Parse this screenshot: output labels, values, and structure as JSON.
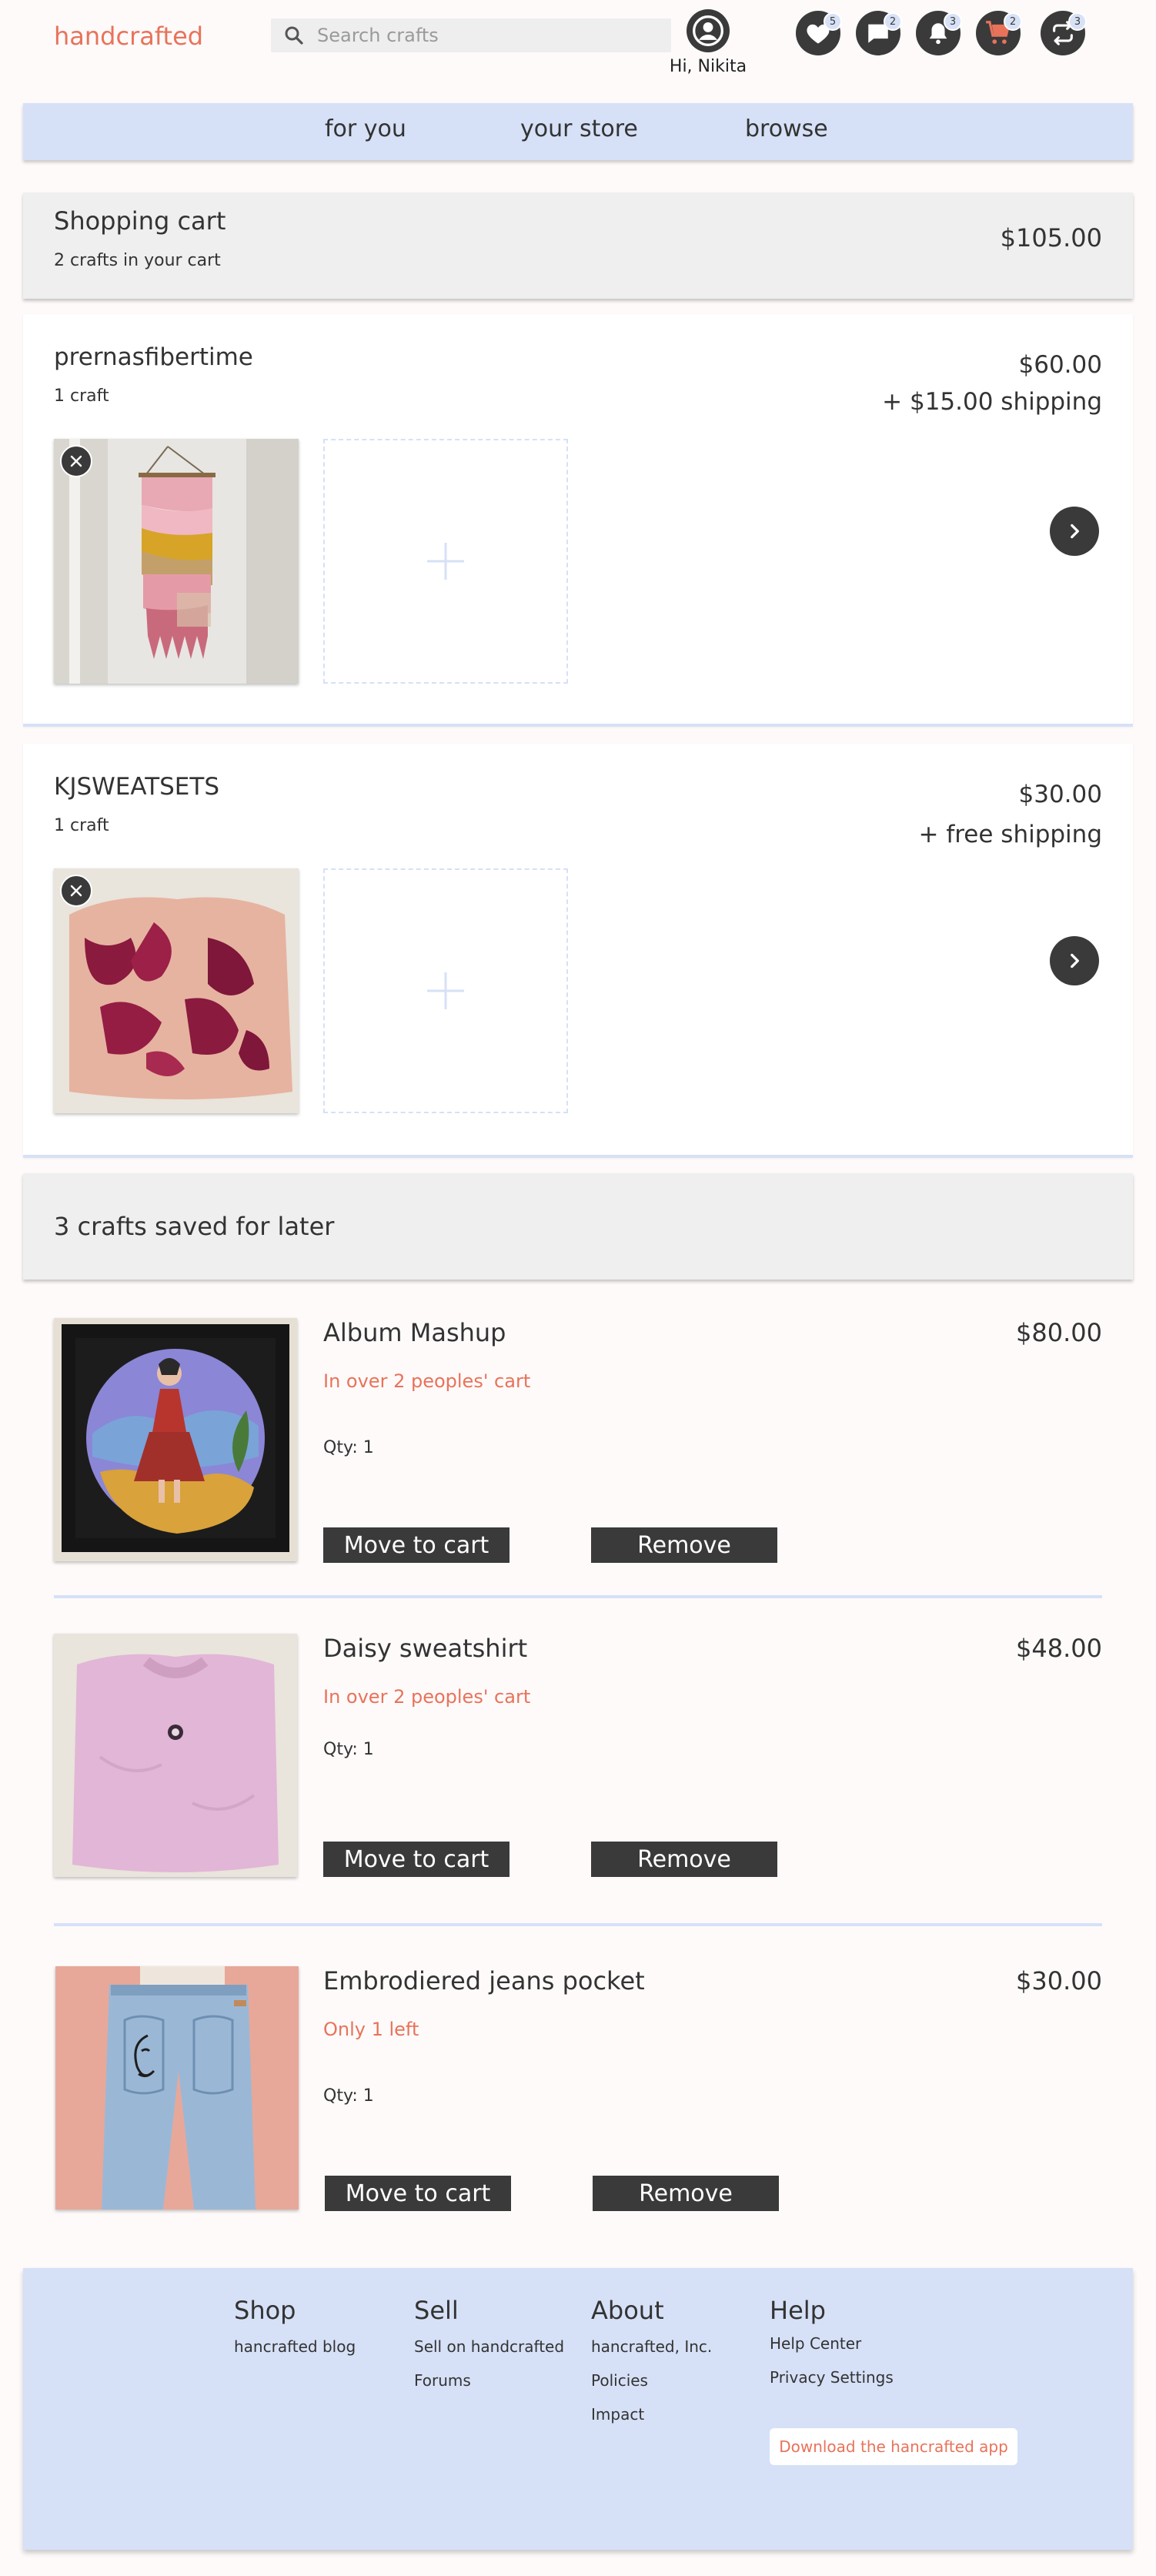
{
  "header": {
    "logo": "handcrafted",
    "search_placeholder": "Search crafts",
    "greeting": "Hi, Nikita",
    "icons": [
      {
        "name": "favorites",
        "badge": "5"
      },
      {
        "name": "messages",
        "badge": "2"
      },
      {
        "name": "notifications",
        "badge": "3"
      },
      {
        "name": "cart",
        "badge": "2"
      },
      {
        "name": "swap",
        "badge": "3"
      }
    ]
  },
  "nav": {
    "items": [
      "for you",
      "your store",
      "browse"
    ]
  },
  "cart": {
    "title": "Shopping cart",
    "count_text": "2 crafts in your cart",
    "total": "$105.00",
    "shops": [
      {
        "name": "prernasfibertime",
        "count": "1 craft",
        "price": "$60.00",
        "shipping": "+ $15.00 shipping"
      },
      {
        "name": "KJSWEATSETS",
        "count": "1 craft",
        "price": "$30.00",
        "shipping": "+ free shipping"
      }
    ]
  },
  "saved": {
    "title": "3 crafts saved for later",
    "move_label": "Move to cart",
    "remove_label": "Remove",
    "items": [
      {
        "name": "Album Mashup",
        "status": "In over 2 peoples' cart",
        "qty": "Qty: 1",
        "price": "$80.00"
      },
      {
        "name": "Daisy sweatshirt",
        "status": "In over 2 peoples' cart",
        "qty": "Qty: 1",
        "price": "$48.00"
      },
      {
        "name": "Embrodiered jeans pocket",
        "status": "Only 1 left",
        "qty": "Qty: 1",
        "price": "$30.00"
      }
    ]
  },
  "footer": {
    "shop": {
      "title": "Shop",
      "links": [
        "hancrafted blog"
      ]
    },
    "sell": {
      "title": "Sell",
      "links": [
        "Sell on handcrafted",
        "Forums"
      ]
    },
    "about": {
      "title": "About",
      "links": [
        "hancrafted, Inc.",
        "Policies",
        "Impact"
      ]
    },
    "help": {
      "title": "Help",
      "links": [
        "Help Center",
        "Privacy Settings"
      ]
    },
    "app_button": "Download the hancrafted app"
  },
  "colors": {
    "accent": "#e8735a",
    "nav_bg": "#d6e1f7",
    "dark": "#3a3a3a",
    "panel": "#efefef"
  }
}
